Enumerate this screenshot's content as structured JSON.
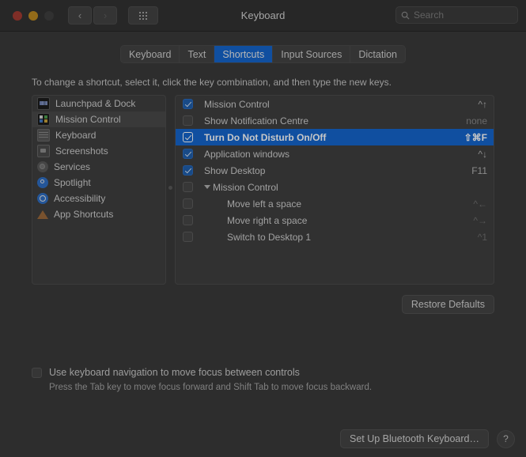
{
  "window": {
    "title": "Keyboard",
    "traffic_lights": [
      "close",
      "minimize",
      "zoom"
    ],
    "nav_back_label": "‹",
    "nav_forward_label": "›",
    "grid_button_name": "show-all-preferences"
  },
  "search": {
    "placeholder": "Search",
    "value": ""
  },
  "tabs": [
    {
      "label": "Keyboard",
      "active": false
    },
    {
      "label": "Text",
      "active": false
    },
    {
      "label": "Shortcuts",
      "active": true
    },
    {
      "label": "Input Sources",
      "active": false
    },
    {
      "label": "Dictation",
      "active": false
    }
  ],
  "hint": "To change a shortcut, select it, click the key combination, and then type the new keys.",
  "sidebar": {
    "items": [
      {
        "label": "Launchpad & Dock",
        "icon": "launchpad-dock-icon",
        "selected": false
      },
      {
        "label": "Mission Control",
        "icon": "mission-control-icon",
        "selected": true
      },
      {
        "label": "Keyboard",
        "icon": "keyboard-icon",
        "selected": false
      },
      {
        "label": "Screenshots",
        "icon": "screenshots-icon",
        "selected": false
      },
      {
        "label": "Services",
        "icon": "services-icon",
        "selected": false
      },
      {
        "label": "Spotlight",
        "icon": "spotlight-icon",
        "selected": false
      },
      {
        "label": "Accessibility",
        "icon": "accessibility-icon",
        "selected": false
      },
      {
        "label": "App Shortcuts",
        "icon": "app-shortcuts-icon",
        "selected": false
      }
    ]
  },
  "shortcuts": [
    {
      "label": "Mission Control",
      "key": "^↑",
      "checked": true,
      "selected": false,
      "indent": 0,
      "group": false,
      "dim": false
    },
    {
      "label": "Show Notification Centre",
      "key": "none",
      "checked": false,
      "selected": false,
      "indent": 0,
      "group": false,
      "dim": false,
      "none": true
    },
    {
      "label": "Turn Do Not Disturb On/Off",
      "key": "⇧⌘F",
      "checked": true,
      "selected": true,
      "indent": 0,
      "group": false,
      "dim": false
    },
    {
      "label": "Application windows",
      "key": "^↓",
      "checked": true,
      "selected": false,
      "indent": 0,
      "group": false,
      "dim": false
    },
    {
      "label": "Show Desktop",
      "key": "F11",
      "checked": true,
      "selected": false,
      "indent": 0,
      "group": false,
      "dim": false
    },
    {
      "label": "Mission Control",
      "key": "",
      "checked": false,
      "selected": false,
      "indent": 0,
      "group": true,
      "dim": false
    },
    {
      "label": "Move left a space",
      "key": "^←",
      "checked": false,
      "selected": false,
      "indent": 1,
      "group": false,
      "dim": true
    },
    {
      "label": "Move right a space",
      "key": "^→",
      "checked": false,
      "selected": false,
      "indent": 1,
      "group": false,
      "dim": true
    },
    {
      "label": "Switch to Desktop 1",
      "key": "^1",
      "checked": false,
      "selected": false,
      "indent": 1,
      "group": false,
      "dim": true
    }
  ],
  "restore_defaults_label": "Restore Defaults",
  "keyboard_navigation": {
    "label": "Use keyboard navigation to move focus between controls",
    "checked": false,
    "sub": "Press the Tab key to move focus forward and Shift Tab to move focus backward."
  },
  "footer": {
    "bluetooth_label": "Set Up Bluetooth Keyboard…",
    "help_label": "?"
  },
  "colors": {
    "accent": "#1566cd",
    "window_bg": "#3a3a3a",
    "pane_bg": "#3f3f3f",
    "titlebar_bg": "#333333",
    "text": "#cfcfcf"
  }
}
